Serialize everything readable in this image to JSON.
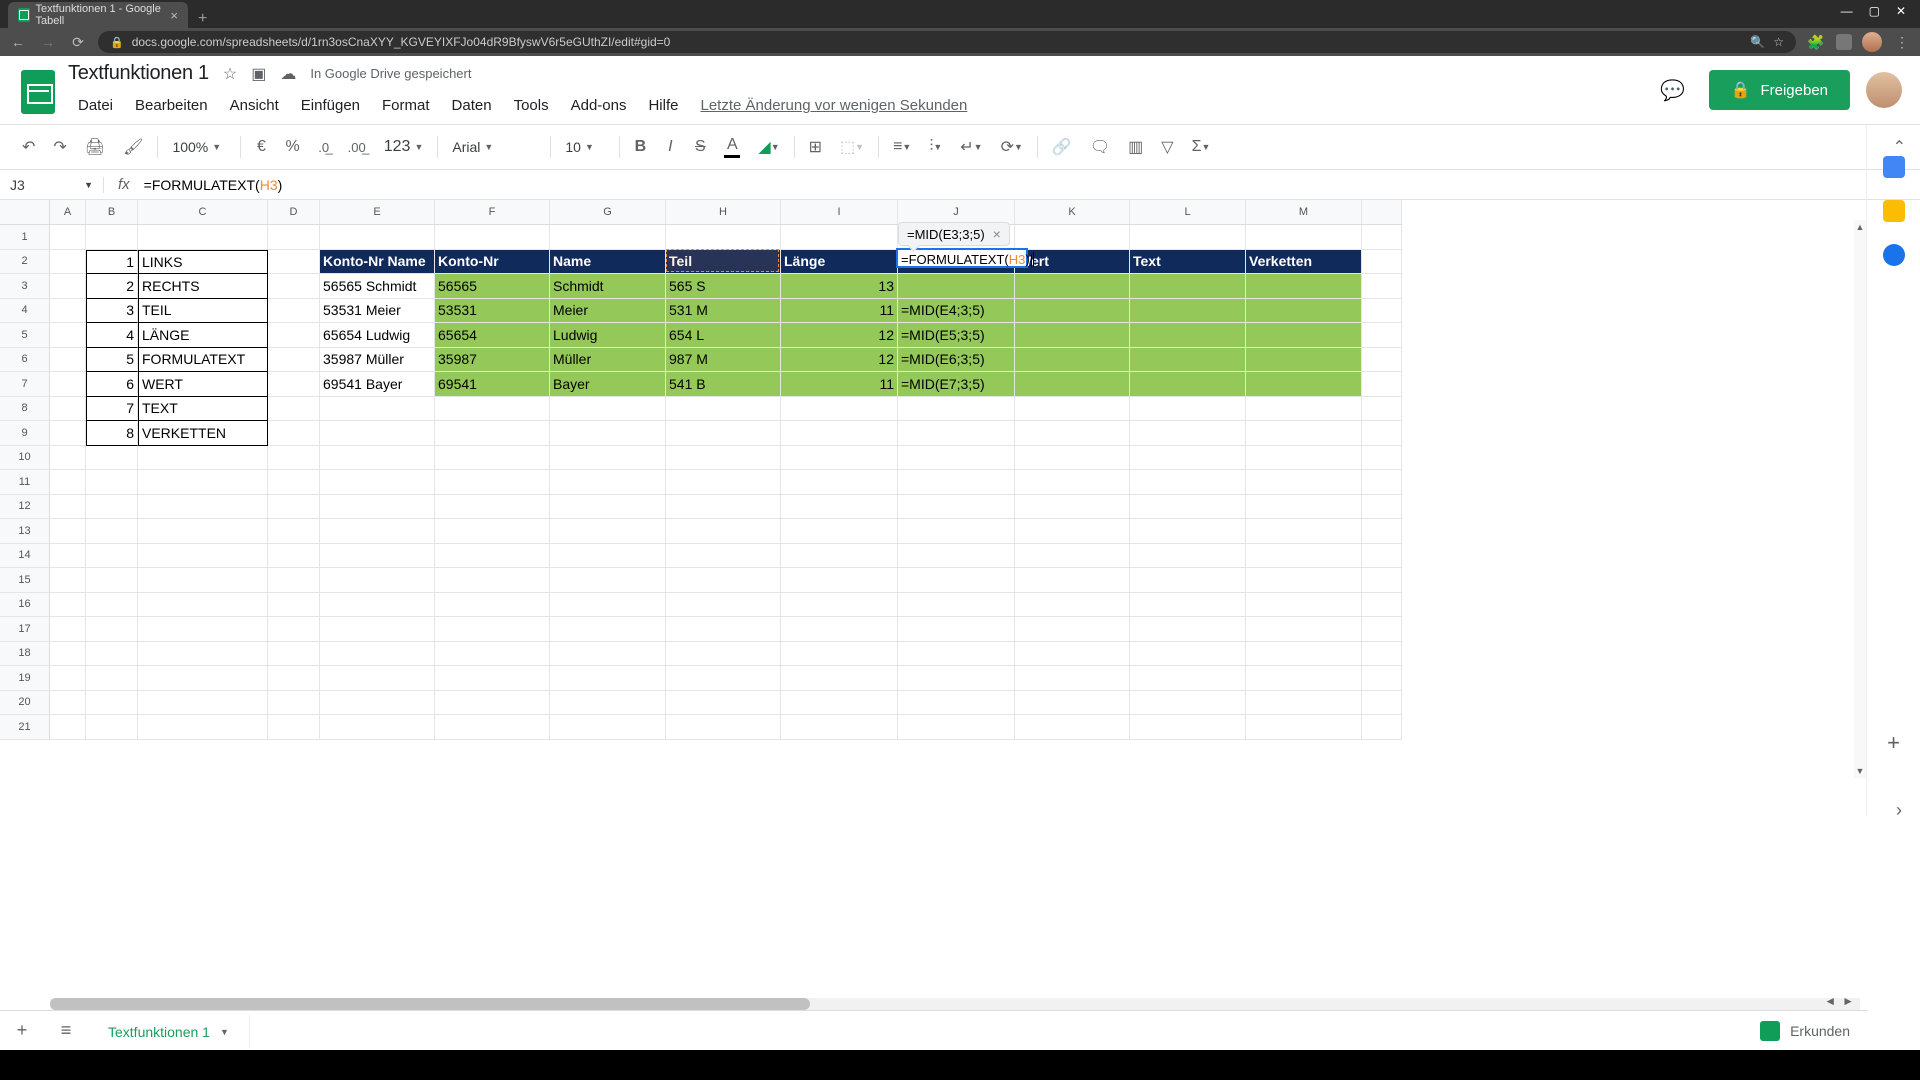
{
  "browser": {
    "tab_title": "Textfunktionen 1 - Google Tabell",
    "url": "docs.google.com/spreadsheets/d/1rn3osCnaXYY_KGVEYIXFJo04dR9BfyswV6r5eGUthZI/edit#gid=0"
  },
  "header": {
    "doc_title": "Textfunktionen 1",
    "save_status": "In Google Drive gespeichert",
    "menus": [
      "Datei",
      "Bearbeiten",
      "Ansicht",
      "Einfügen",
      "Format",
      "Daten",
      "Tools",
      "Add-ons",
      "Hilfe"
    ],
    "last_edit": "Letzte Änderung vor wenigen Sekunden",
    "share_label": "Freigeben"
  },
  "toolbar": {
    "zoom": "100%",
    "currency": "€",
    "percent": "%",
    "dec_less": ".0",
    "dec_more": ".00",
    "num_fmt": "123",
    "font": "Arial",
    "font_size": "10"
  },
  "formula_bar": {
    "name_box": "J3",
    "prefix": "=FORMULATEXT(",
    "ref": "H3",
    "suffix": ")"
  },
  "columns": [
    "A",
    "B",
    "C",
    "D",
    "E",
    "F",
    "G",
    "H",
    "I",
    "J",
    "K",
    "L",
    "M"
  ],
  "row_count": 21,
  "legend": {
    "rows": [
      {
        "n": "1",
        "t": "LINKS"
      },
      {
        "n": "2",
        "t": "RECHTS"
      },
      {
        "n": "3",
        "t": "TEIL"
      },
      {
        "n": "4",
        "t": "LÄNGE"
      },
      {
        "n": "5",
        "t": "FORMULATEXT"
      },
      {
        "n": "6",
        "t": "WERT"
      },
      {
        "n": "7",
        "t": "TEXT"
      },
      {
        "n": "8",
        "t": "VERKETTEN"
      }
    ]
  },
  "data": {
    "headers": {
      "E": "Konto-Nr Name",
      "F": "Konto-Nr",
      "G": "Name",
      "H": "Teil",
      "I": "Länge",
      "J": "",
      "K": "Wert",
      "L": "Text",
      "M": "Verketten"
    },
    "rows": [
      {
        "E": "56565 Schmidt",
        "F": "56565",
        "G": "Schmidt",
        "H": "565 S",
        "I": "13",
        "J": "=MID(E3;3;5)"
      },
      {
        "E": "53531 Meier",
        "F": "53531",
        "G": "Meier",
        "H": "531 M",
        "I": "11",
        "J": "=MID(E4;3;5)"
      },
      {
        "E": "65654 Ludwig",
        "F": "65654",
        "G": "Ludwig",
        "H": "654 L",
        "I": "12",
        "J": "=MID(E5;3;5)"
      },
      {
        "E": "35987 Müller",
        "F": "35987",
        "G": "Müller",
        "H": "987 M",
        "I": "12",
        "J": "=MID(E6;3;5)"
      },
      {
        "E": "69541 Bayer",
        "F": "69541",
        "G": "Bayer",
        "H": "541 B",
        "I": "11",
        "J": "=MID(E7;3;5)"
      }
    ]
  },
  "editing": {
    "preview": "=MID(E3;3;5)",
    "text_pre": "=FORMULATEXT(",
    "ref": "H3",
    "text_post": ")"
  },
  "sheet_bar": {
    "tab_name": "Textfunktionen 1",
    "explore": "Erkunden"
  }
}
